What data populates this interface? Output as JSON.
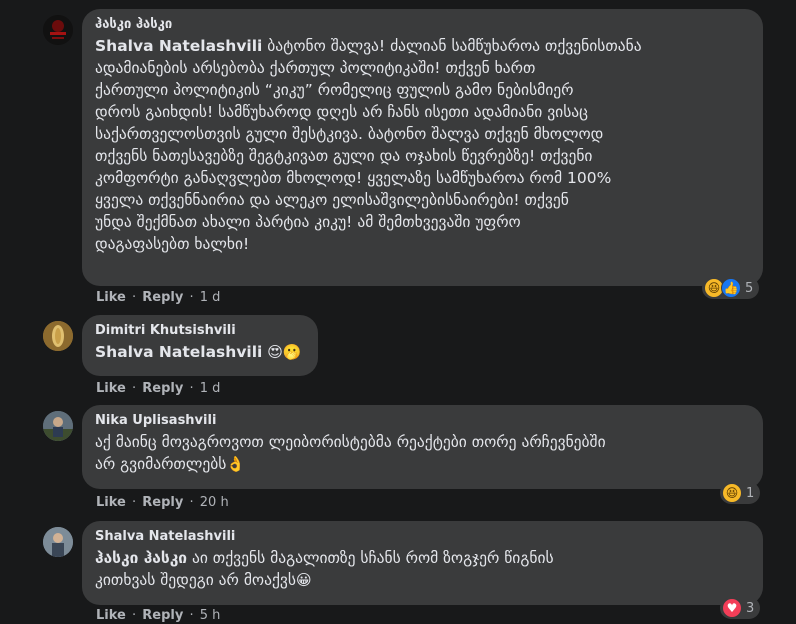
{
  "comments": [
    {
      "author": "ჰასკი ჰასკი",
      "mention": "Shalva Natelashvili",
      "text_lines": [
        " ბატონო შალვა! ძალიან სამწუხაროა თქვენისთანა",
        "ადამიანების არსებობა ქართულ პოლიტიკაში! თქვენ ხართ",
        "ქართული პოლიტიკის “კიკუ” რომელიც ფულის გამო ნებისმიერ",
        "დროს გაიხდის! სამწუხაროდ დღეს არ ჩანს ისეთი ადამიანი ვისაც",
        "საქართველოსთვის გული შესტკივა. ბატონო შალვა თქვენ მხოლოდ",
        "თქვენს ნათესავებზე შეგტკივათ გული და ოჯახის წევრებზე! თქვენი",
        "კომფორტი განაღვლებთ მხოლოდ! ყველაზე სამწუხაროა რომ 100%",
        "ყველა თქვენნაირია და ალეკო ელისაშვილებისნაირები! თქვენ",
        "უნდა შექმნათ ახალი პარტია კიკუ! ამ შემთხვევაში უფრო",
        "დაგაფასებთ ხალხი!"
      ],
      "like": "Like",
      "reply": "Reply",
      "time": "1 d",
      "reaction_count": "5"
    },
    {
      "author": "Dimitri Khutsishvili",
      "mention": "Shalva Natelashvili",
      "emojis": "😍🫢",
      "like": "Like",
      "reply": "Reply",
      "time": "1 d"
    },
    {
      "author": "Nika Uplisashvili",
      "text_lines": [
        "აქ მაინც მოვაგროვოთ ლეიბორისტებმა რეაქტები თორე არჩევნებში",
        "არ გვიმართლებს"
      ],
      "emoji": "👌",
      "like": "Like",
      "reply": "Reply",
      "time": "20 h",
      "reaction_count": "1"
    },
    {
      "author": "Shalva Natelashvili",
      "mention": "ჰასკი ჰასკი",
      "text_lines": [
        " აი თქვენს მაგალითზე სჩანს რომ ზოგჯერ წიგნის",
        "კითხვას შედეგი არ მოაქვს"
      ],
      "emoji": "😀",
      "like": "Like",
      "reply": "Reply",
      "time": "5 h",
      "reaction_count": "3"
    }
  ],
  "separator": "·",
  "colors": {
    "background": "#18191a",
    "bubble": "#3a3b3c",
    "text": "#e4e6eb",
    "secondary": "#b0b3b8",
    "like_blue": "#1877f2",
    "love_red": "#f33e58",
    "haha_yellow": "#f7b928"
  },
  "icons": {
    "reaction_haha": "haha-icon",
    "reaction_like": "like-icon",
    "reaction_love": "love-icon"
  }
}
